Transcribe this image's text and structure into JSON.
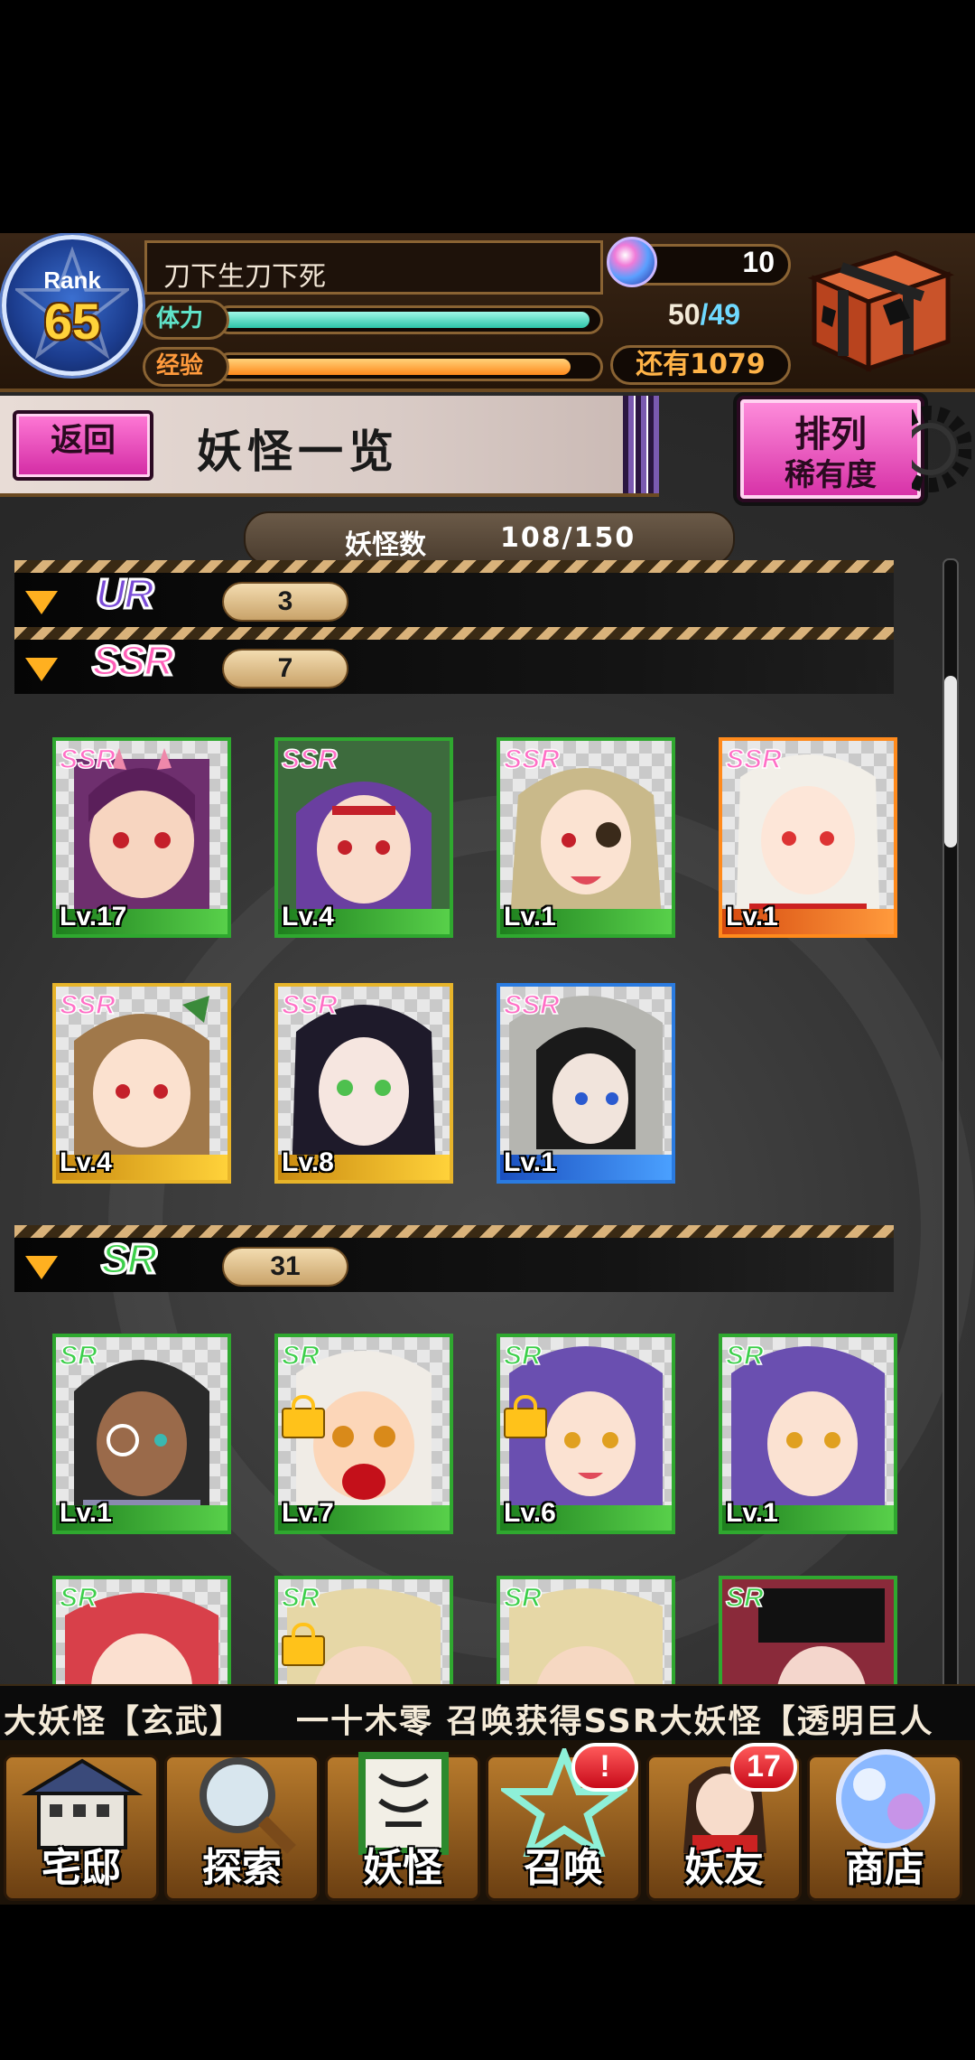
{
  "player": {
    "rank_label": "Rank",
    "rank": "65",
    "name": "刀下生刀下死",
    "hp_label": "体力",
    "hp_fill": 0.98,
    "exp_label": "经验",
    "exp_fill": 0.93,
    "gems": "10",
    "stamina_current": "50",
    "stamina_sep": "/",
    "stamina_max": "49",
    "exp_remaining": "还有1079"
  },
  "header": {
    "back_label": "返回",
    "title": "妖怪一览",
    "sort_label": "排列",
    "sort_value": "稀有度"
  },
  "collection": {
    "count_label": "妖怪数",
    "count_value": "108/150"
  },
  "groups": [
    {
      "rarity": "UR",
      "count": "3"
    },
    {
      "rarity": "SSR",
      "count": "7"
    },
    {
      "rarity": "SR",
      "count": "31"
    }
  ],
  "ssr_cards": [
    {
      "tag": "SSR",
      "level": "Lv.17",
      "frame": "green"
    },
    {
      "tag": "SSR",
      "level": "Lv.4",
      "frame": "green"
    },
    {
      "tag": "SSR",
      "level": "Lv.1",
      "frame": "green"
    },
    {
      "tag": "SSR",
      "level": "Lv.1",
      "frame": "orange"
    },
    {
      "tag": "SSR",
      "level": "Lv.4",
      "frame": "gold"
    },
    {
      "tag": "SSR",
      "level": "Lv.8",
      "frame": "gold"
    },
    {
      "tag": "SSR",
      "level": "Lv.1",
      "frame": "blue"
    }
  ],
  "sr_cards": [
    {
      "tag": "SR",
      "level": "Lv.1",
      "locked": false
    },
    {
      "tag": "SR",
      "level": "Lv.7",
      "locked": true
    },
    {
      "tag": "SR",
      "level": "Lv.6",
      "locked": true
    },
    {
      "tag": "SR",
      "level": "Lv.1",
      "locked": false
    },
    {
      "tag": "SR",
      "level": "",
      "locked": false
    },
    {
      "tag": "SR",
      "level": "",
      "locked": true
    },
    {
      "tag": "SR",
      "level": "",
      "locked": false
    },
    {
      "tag": "SR",
      "level": "",
      "locked": false
    }
  ],
  "ticker": "大妖怪【玄武】　　一十木零 召唤获得SSR大妖怪【透明巨人",
  "nav": [
    {
      "label": "宅邸",
      "icon": "house-icon",
      "badge": ""
    },
    {
      "label": "探索",
      "icon": "magnifier-icon",
      "badge": ""
    },
    {
      "label": "妖怪",
      "icon": "scroll-icon",
      "badge": ""
    },
    {
      "label": "召唤",
      "icon": "pentagram-icon",
      "badge": "!"
    },
    {
      "label": "妖友",
      "icon": "friend-icon",
      "badge": "17"
    },
    {
      "label": "商店",
      "icon": "orb-icon",
      "badge": ""
    }
  ],
  "colors": {
    "accent_pink": "#d22aa3",
    "hp_teal": "#2cc4a8",
    "exp_orange": "#ff8a1c",
    "frame_green": "#2fa82f"
  }
}
